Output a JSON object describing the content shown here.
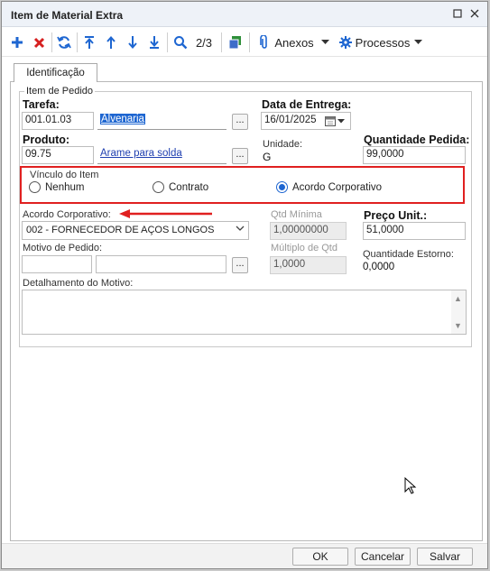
{
  "window": {
    "title": "Item de Material Extra"
  },
  "toolbar": {
    "page_indicator": "2/3",
    "anexos_label": "Anexos",
    "processos_label": "Processos",
    "colors": {
      "add": "#1e66d1",
      "delete": "#d62020",
      "nav": "#1e66d1"
    }
  },
  "tabs": [
    {
      "label": "Identificação"
    }
  ],
  "form": {
    "group_label": "Item de Pedido",
    "tarefa": {
      "label": "Tarefa:",
      "code": "001.01.03",
      "description": "Alvenaria"
    },
    "data_entrega": {
      "label": "Data de Entrega:",
      "value": "16/01/2025"
    },
    "produto": {
      "label": "Produto:",
      "code": "09.75",
      "description": "Arame para solda"
    },
    "unidade": {
      "label": "Unidade:",
      "value": "G"
    },
    "quantidade_pedida": {
      "label": "Quantidade Pedida:",
      "value": "99,0000"
    },
    "vinculo": {
      "label": "Vínculo do Item",
      "options": [
        {
          "label": "Nenhum",
          "selected": false
        },
        {
          "label": "Contrato",
          "selected": false
        },
        {
          "label": "Acordo Corporativo",
          "selected": true
        }
      ]
    },
    "acordo": {
      "label": "Acordo Corporativo:",
      "value": "002 - FORNECEDOR DE AÇOS LONGOS"
    },
    "qtd_minima": {
      "label": "Qtd Mínima",
      "value": "1,00000000"
    },
    "preco_unit": {
      "label": "Preço Unit.:",
      "value": "51,0000"
    },
    "motivo": {
      "label": "Motivo de Pedido:",
      "code": "",
      "description": ""
    },
    "multiplo": {
      "label": "Múltiplo de Qtd",
      "value": "1,0000"
    },
    "quantidade_estorno": {
      "label": "Quantidade Estorno:",
      "value": "0,0000"
    },
    "detalhamento": {
      "label": "Detalhamento do Motivo:",
      "value": ""
    },
    "annotation_color": "#e02020"
  },
  "footer": {
    "ok": "OK",
    "cancel": "Cancelar",
    "save": "Salvar"
  }
}
